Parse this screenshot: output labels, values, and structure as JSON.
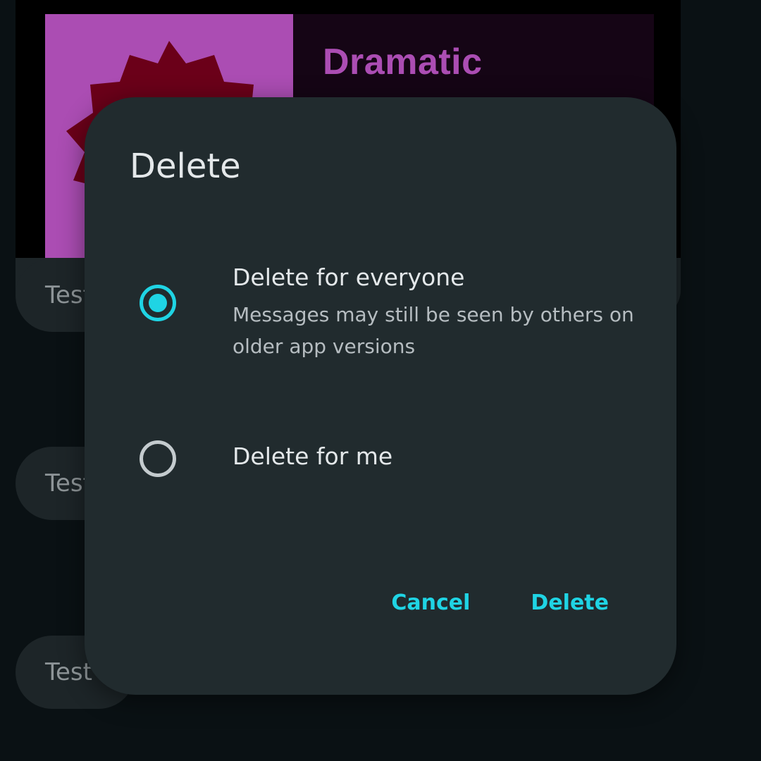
{
  "background_chat": {
    "sticker_title": "Dramatic",
    "bubbles": [
      "Test",
      "Test",
      "Test"
    ]
  },
  "dialog": {
    "title": "Delete",
    "options": [
      {
        "label": "Delete for everyone",
        "description": "Messages may still be seen by others on older app versions",
        "selected": true
      },
      {
        "label": "Delete for me",
        "selected": false
      }
    ],
    "cancel_label": "Cancel",
    "confirm_label": "Delete"
  },
  "colors": {
    "accent": "#1fd4e4",
    "dialog_bg": "#212b2e",
    "screen_bg": "#0a1114",
    "sticker_pink": "#ab4db3",
    "sticker_burst": "#6b0019"
  }
}
